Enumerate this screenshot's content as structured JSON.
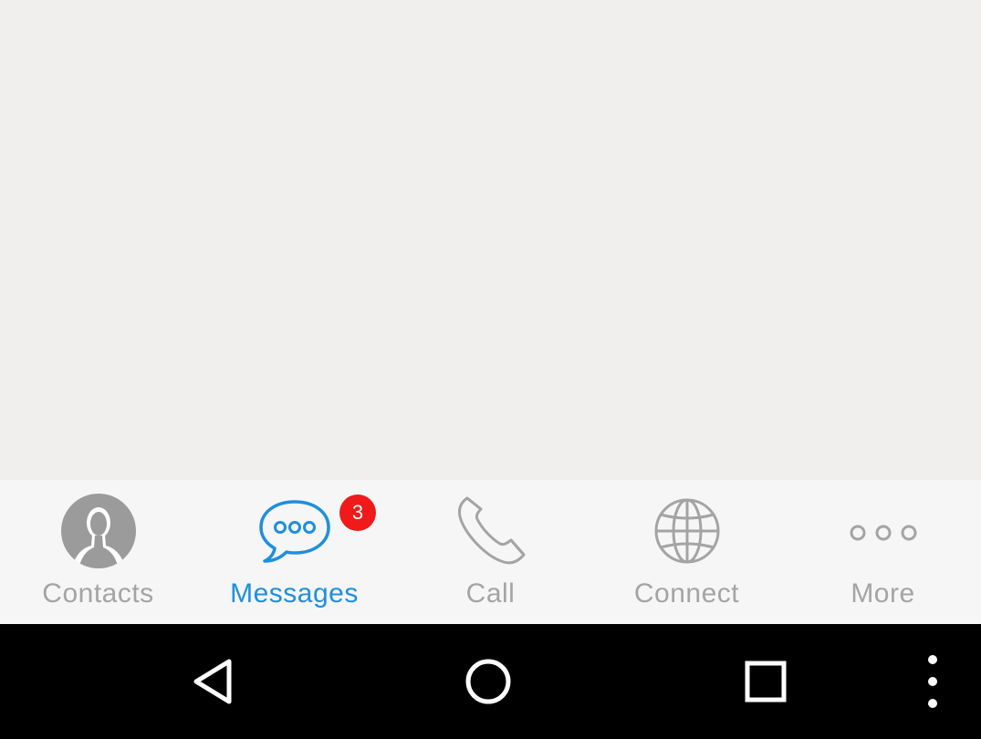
{
  "tabs": [
    {
      "id": "contacts",
      "label": "Contacts",
      "icon": "person-icon",
      "active": false
    },
    {
      "id": "messages",
      "label": "Messages",
      "icon": "chat-bubble-icon",
      "active": true,
      "badge": "3"
    },
    {
      "id": "call",
      "label": "Call",
      "icon": "phone-icon",
      "active": false
    },
    {
      "id": "connect",
      "label": "Connect",
      "icon": "globe-icon",
      "active": false
    },
    {
      "id": "more",
      "label": "More",
      "icon": "more-dots-icon",
      "active": false
    }
  ],
  "nav": {
    "buttons": [
      "back-icon",
      "home-icon",
      "recents-icon",
      "menu-icon"
    ]
  },
  "colors": {
    "background": "#f0efed",
    "tab_bar": "#f6f6f6",
    "inactive": "#a4a4a4",
    "active": "#1e8fe0",
    "badge": "#f01a1a",
    "nav_bar": "#000000"
  }
}
